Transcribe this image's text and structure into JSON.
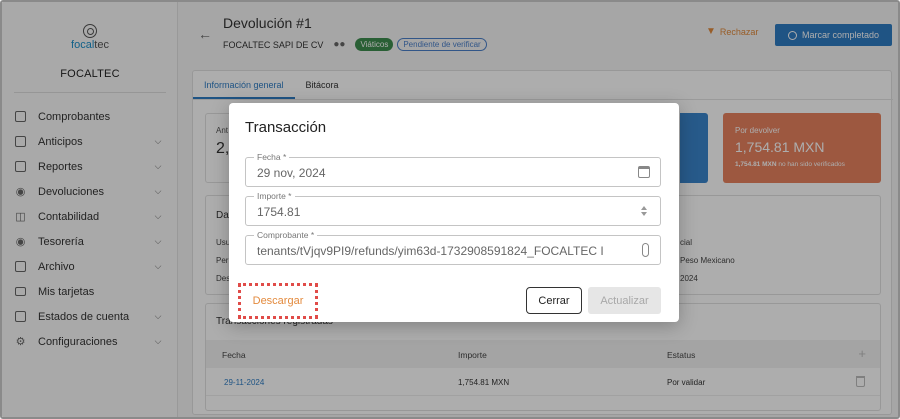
{
  "sidebar": {
    "logo_text_a": "focal",
    "logo_text_b": "tec",
    "company": "FOCALTEC",
    "items": [
      {
        "label": "Comprobantes",
        "icon": "document-icon",
        "expandable": false
      },
      {
        "label": "Anticipos",
        "icon": "cash-icon",
        "expandable": true
      },
      {
        "label": "Reportes",
        "icon": "report-icon",
        "expandable": true
      },
      {
        "label": "Devoluciones",
        "icon": "refund-icon",
        "expandable": true
      },
      {
        "label": "Contabilidad",
        "icon": "bank-icon",
        "expandable": true
      },
      {
        "label": "Tesorería",
        "icon": "piggy-bank-icon",
        "expandable": true
      },
      {
        "label": "Archivo",
        "icon": "archive-icon",
        "expandable": true
      },
      {
        "label": "Mis tarjetas",
        "icon": "card-icon",
        "expandable": false
      },
      {
        "label": "Estados de cuenta",
        "icon": "statement-icon",
        "expandable": true
      },
      {
        "label": "Configuraciones",
        "icon": "gear-icon",
        "expandable": true
      }
    ]
  },
  "header": {
    "title": "Devolución #1",
    "company": "FOCALTEC SAPI DE CV",
    "chip_travel": "Viáticos",
    "chip_status": "Pendiente de verificar",
    "reject_label": "Rechazar",
    "complete_label": "Marcar completado"
  },
  "tabs": [
    "Información general",
    "Bitácora"
  ],
  "cards": {
    "left_label": "Ant",
    "left_value": "2,1",
    "orange_label": "Por devolver",
    "orange_value": "1,754.81 MXN",
    "orange_note_bold": "1,754.81 MXN",
    "orange_note": " no han sido verificados"
  },
  "details": {
    "heading": "Dat",
    "rows_left": [
      "Usu",
      "Per",
      "Des"
    ],
    "rows_right": [
      "cial",
      "Peso Mexicano",
      "2024"
    ]
  },
  "transactions": {
    "heading": "Transacciones registradas",
    "columns": [
      "Fecha",
      "Importe",
      "Estatus"
    ],
    "rows": [
      {
        "fecha": "29-11-2024",
        "importe": "1,754.81 MXN",
        "estatus": "Por validar"
      }
    ]
  },
  "modal": {
    "title": "Transacción",
    "fecha_label": "Fecha *",
    "fecha_value": "29 nov, 2024",
    "importe_label": "Importe *",
    "importe_value": "1754.81",
    "comprobante_label": "Comprobante *",
    "comprobante_value": "tenants/tVjqv9PI9/refunds/yim63d-1732908591824_FOCALTEC I",
    "download_label": "Descargar",
    "close_label": "Cerrar",
    "update_label": "Actualizar"
  }
}
